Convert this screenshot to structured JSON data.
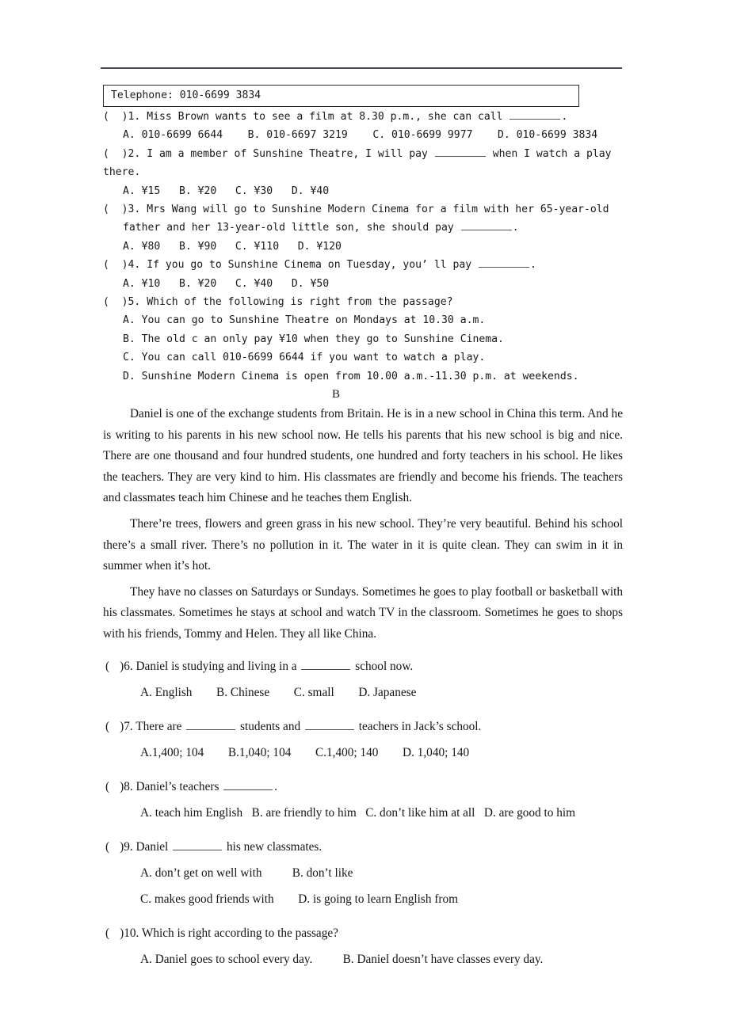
{
  "document": {
    "telephone_box": "Telephone: 010-6699 3834",
    "part_a": {
      "questions": [
        {
          "marker": "(  )1.",
          "stem_before": " Miss Brown wants to see a film at 8.30 p.m., she can call ",
          "stem_after": ".",
          "options_line": "A. 010-6699 6644    B. 010-6697 3219    C. 010-6699 9977    D. 010-6699 3834"
        },
        {
          "marker": "(  )2.",
          "stem_before": " I am a member of Sunshine Theatre, I will pay ",
          "stem_after": " when I watch a play",
          "continuation": "there.",
          "options_line": "A. ¥15   B. ¥20   C. ¥30   D. ¥40"
        },
        {
          "marker": "(  )3.",
          "stem_before": " Mrs Wang will go to Sunshine Modern Cinema for a film with her 65-year-old",
          "continuation_before": "father and her 13-year-old little son, she should pay ",
          "continuation_after": ".",
          "options_line": "A. ¥80   B. ¥90   C. ¥110   D. ¥120"
        },
        {
          "marker": "(  )4.",
          "stem_before": " If you go to Sunshine Cinema on Tuesday, you’ ll pay ",
          "stem_after": ".",
          "options_line": "A. ¥10   B. ¥20   C. ¥40   D. ¥50"
        },
        {
          "marker": "(  )5.",
          "stem_before": " Which of the following is right from the passage?",
          "options": [
            "A. You can go to Sunshine Theatre on Mondays at 10.30 a.m.",
            "B. The old c an only pay ¥10 when they go to Sunshine Cinema.",
            "C. You can call 010-6699 6644 if you want to watch a play.",
            "D. Sunshine Modern Cinema is open from 10.00 a.m.-11.30 p.m. at weekends."
          ]
        }
      ]
    },
    "section_letter": "B",
    "part_b": {
      "paragraphs": [
        "Daniel is one of the exchange students from Britain. He is in a new school in China this term. And he is writing to his parents in his new school now. He tells his parents that his new school is big and nice. There are one thousand and four hundred students, one hundred and forty teachers in his school. He likes the teachers. They are very kind to him. His classmates are friendly and become his friends. The teachers and classmates teach him Chinese and he teaches them English.",
        "There’re trees, flowers and green grass in his new school. They’re very beautiful. Behind his school there’s a small river. There’s no pollution in it. The water in it is quite clean. They can swim in it in summer when it’s hot.",
        "They have no classes on Saturdays or Sundays. Sometimes he goes to play football or basketball with his classmates. Sometimes he stays at school and watch TV in the classroom. Sometimes he goes to shops with his friends, Tommy and Helen. They all like China."
      ],
      "questions": [
        {
          "marker": "(",
          "marker_close": ")6.",
          "stem_before": " Daniel is studying and living in a ",
          "stem_after": " school now.",
          "options_line": "A. English  B. Chinese  C. small  D. Japanese"
        },
        {
          "marker": "(",
          "marker_close": ")7.",
          "stem_before": " There are ",
          "stem_mid": " students and ",
          "stem_after": " teachers in Jack’s school.",
          "options_line": "A.1,400; 104  B.1,040; 104  C.1,400; 140  D. 1,040; 140"
        },
        {
          "marker": "(",
          "marker_close": ")8.",
          "stem_before": " Daniel’s teachers ",
          "stem_after": ".",
          "options_line": "A. teach him English  B. are friendly to him  C. don’t like him at all  D. are good to him"
        },
        {
          "marker": "(",
          "marker_close": ")9.",
          "stem_before": " Daniel ",
          "stem_after": " his new classmates.",
          "options_line_1": "A. don’t get on well with   B. don’t like",
          "options_line_2": "C. makes good friends with  D. is going to learn English from"
        },
        {
          "marker": "(",
          "marker_close": ")10.",
          "stem_before": " Which is right according to the passage?",
          "options_line": "A. Daniel goes to school every day.   B. Daniel doesn’t have classes every day."
        }
      ]
    }
  }
}
